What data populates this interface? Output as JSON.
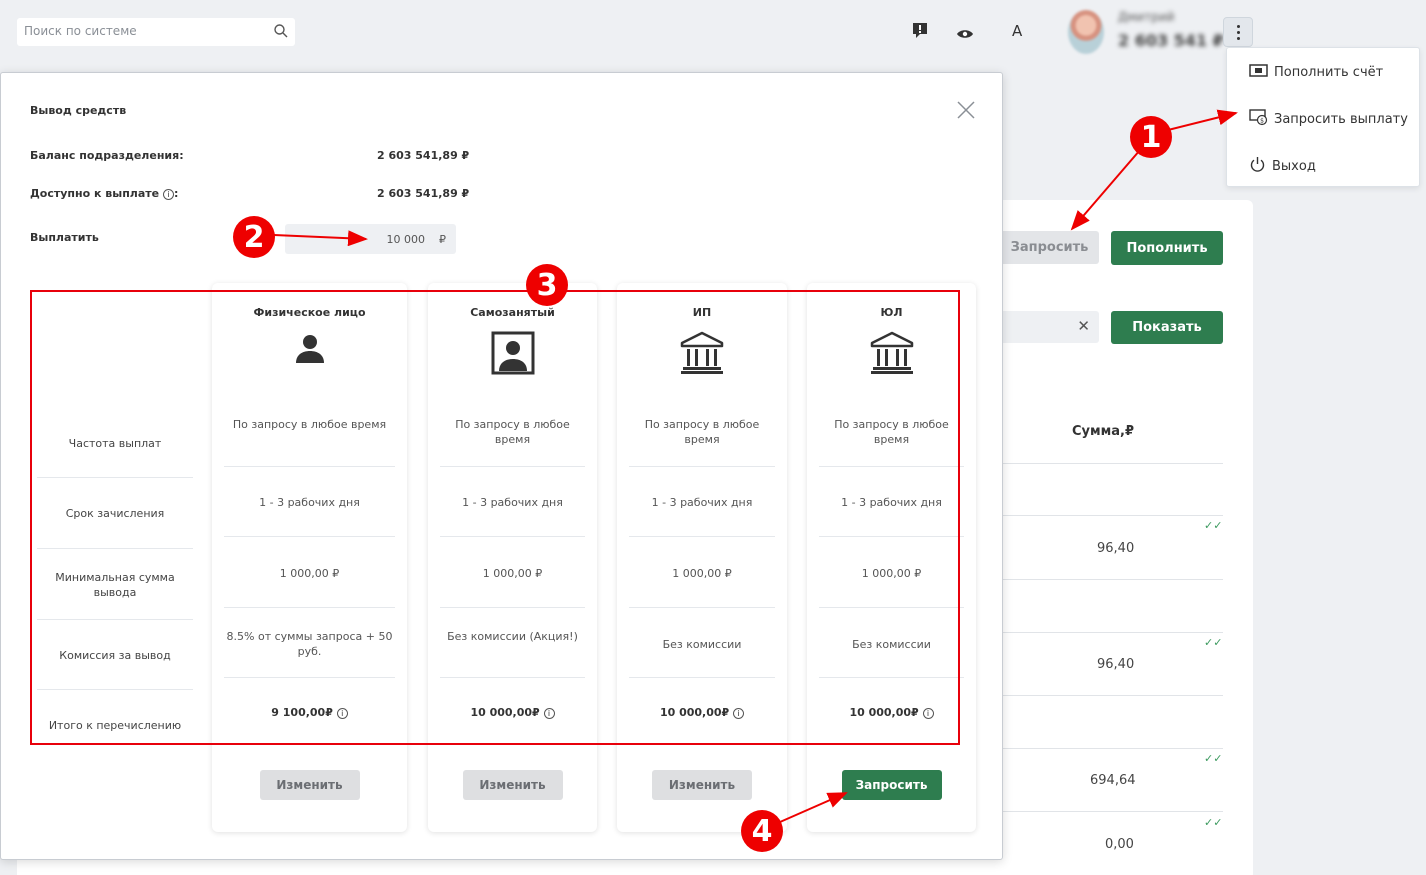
{
  "header": {
    "search_placeholder": "Поиск по системе",
    "user_name": "Дмитрий",
    "user_id": "2 603 541 ₽"
  },
  "menu": {
    "items": [
      {
        "label": "Пополнить счёт",
        "icon": "cash-icon"
      },
      {
        "label": "Запросить выплату",
        "icon": "payout-icon"
      },
      {
        "label": "Выход",
        "icon": "power-icon"
      }
    ]
  },
  "background": {
    "request_button": "Запросить",
    "topup_button": "Пополнить",
    "show_button": "Показать",
    "sum_header": "Сумма,₽",
    "amounts": [
      "96,40",
      "96,40",
      "694,64",
      "0,00"
    ]
  },
  "modal": {
    "title": "Вывод средств",
    "balance_label": "Баланс подразделения:",
    "balance_value": "2 603 541,89 ₽",
    "available_label": "Доступно к выплате",
    "available_value": "2 603 541,89 ₽",
    "pay_label": "Выплатить",
    "pay_value": "10 000",
    "currency": "₽",
    "row_labels": [
      "Частота выплат",
      "Срок зачисления",
      "Минимальная сумма вывода",
      "Комиссия за вывод",
      "Итого к перечислению"
    ],
    "plans": [
      {
        "title": "Физическое лицо",
        "icon": "person-icon",
        "frequency": "По запросу в любое время",
        "term": "1 - 3 рабочих дня",
        "min": "1 000,00 ₽",
        "fee": "8.5% от суммы запроса + 50 руб.",
        "total": "9 100,00₽",
        "button": "Изменить"
      },
      {
        "title": "Самозанятый",
        "icon": "id-card-icon",
        "frequency": "По запросу в любое время",
        "term": "1 - 3 рабочих дня",
        "min": "1 000,00 ₽",
        "fee": "Без комиссии (Акция!)",
        "total": "10 000,00₽",
        "button": "Изменить"
      },
      {
        "title": "ИП",
        "icon": "bank-icon",
        "frequency": "По запросу в любое время",
        "term": "1 - 3 рабочих дня",
        "min": "1 000,00 ₽",
        "fee": "Без комиссии",
        "total": "10 000,00₽",
        "button": "Изменить"
      },
      {
        "title": "ЮЛ",
        "icon": "bank-icon",
        "frequency": "По запросу в любое время",
        "term": "1 - 3 рабочих дня",
        "min": "1 000,00 ₽",
        "fee": "Без комиссии",
        "total": "10 000,00₽",
        "button": "Запросить"
      }
    ]
  },
  "annotations": [
    "1",
    "2",
    "3",
    "4"
  ],
  "colors": {
    "accent": "#2e7d4f",
    "annotation": "#ee0000",
    "background": "#eef0f3"
  }
}
